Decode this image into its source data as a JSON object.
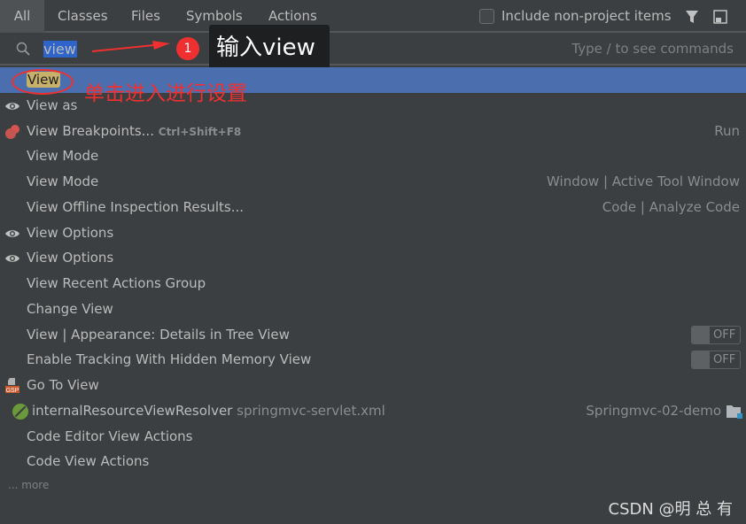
{
  "tabs": [
    {
      "label": "All",
      "active": true
    },
    {
      "label": "Classes"
    },
    {
      "label": "Files"
    },
    {
      "label": "Symbols"
    },
    {
      "label": "Actions"
    }
  ],
  "include_label": "Include non-project items",
  "include_checked": false,
  "search": {
    "value": "view",
    "hint": "Type / to see commands"
  },
  "annotation": {
    "badge": "1",
    "tooltip": "输入view",
    "click_note": "单击进入进行设置",
    "color": "#f03030"
  },
  "results": [
    {
      "label": "View",
      "selected": true,
      "highlight": true
    },
    {
      "label": "View as",
      "icon": "eye-icon"
    },
    {
      "label": "View Breakpoints...",
      "shortcut": "Ctrl+Shift+F8",
      "right": "Run",
      "icon": "breakpoints-icon"
    },
    {
      "label": "View Mode"
    },
    {
      "label": "View Mode",
      "right": "Window | Active Tool Window"
    },
    {
      "label": "View Offline Inspection Results...",
      "right": "Code | Analyze Code"
    },
    {
      "label": "View Options",
      "icon": "eye-icon"
    },
    {
      "label": "View Options",
      "icon": "eye-icon"
    },
    {
      "label": "View Recent Actions Group"
    },
    {
      "label": "Change View"
    },
    {
      "label": "View | Appearance: Details in Tree View",
      "toggle": "OFF"
    },
    {
      "label": "Enable Tracking With Hidden Memory View",
      "toggle": "OFF"
    },
    {
      "label": "Go To View",
      "icon": "gsp-file-icon"
    },
    {
      "label": "internalResourceViewResolver",
      "secondary": "springmvc-servlet.xml",
      "right": "Springmvc-02-demo",
      "icon": "spring-bean-icon"
    },
    {
      "label": "Code Editor View Actions"
    },
    {
      "label": "Code View Actions"
    }
  ],
  "more": "... more",
  "watermark": "CSDN @明 总 有",
  "colors": {
    "selection": "#4b6eaf",
    "background": "#3c3f41",
    "highlight": "#c6b06a"
  }
}
